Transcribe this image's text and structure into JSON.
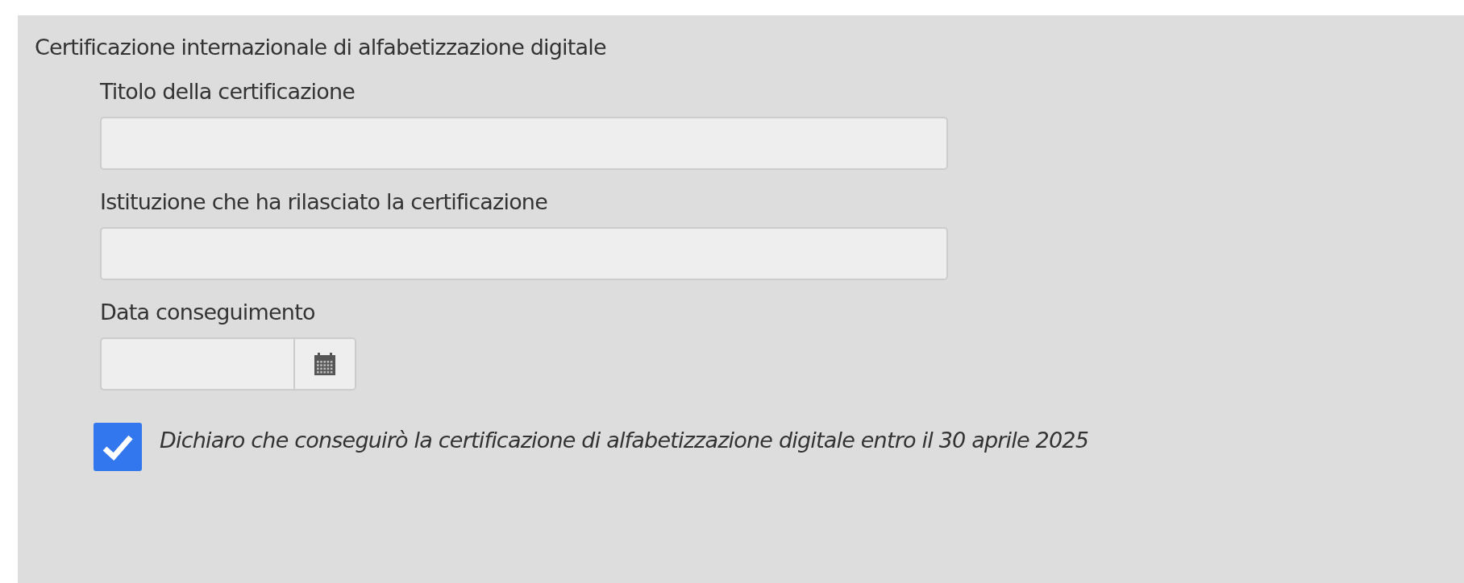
{
  "section": {
    "title": "Certificazione internazionale di alfabetizzazione digitale"
  },
  "fields": [
    {
      "kind": "text",
      "label": "Titolo della certificazione"
    },
    {
      "kind": "text",
      "label": "Istituzione che ha rilasciato la certificazione"
    },
    {
      "kind": "date",
      "label": "Data conseguimento"
    }
  ],
  "declaration": {
    "checked": true,
    "text": "Dichiaro che conseguirò la certificazione di alfabetizzazione digitale entro il 30 aprile 2025"
  }
}
